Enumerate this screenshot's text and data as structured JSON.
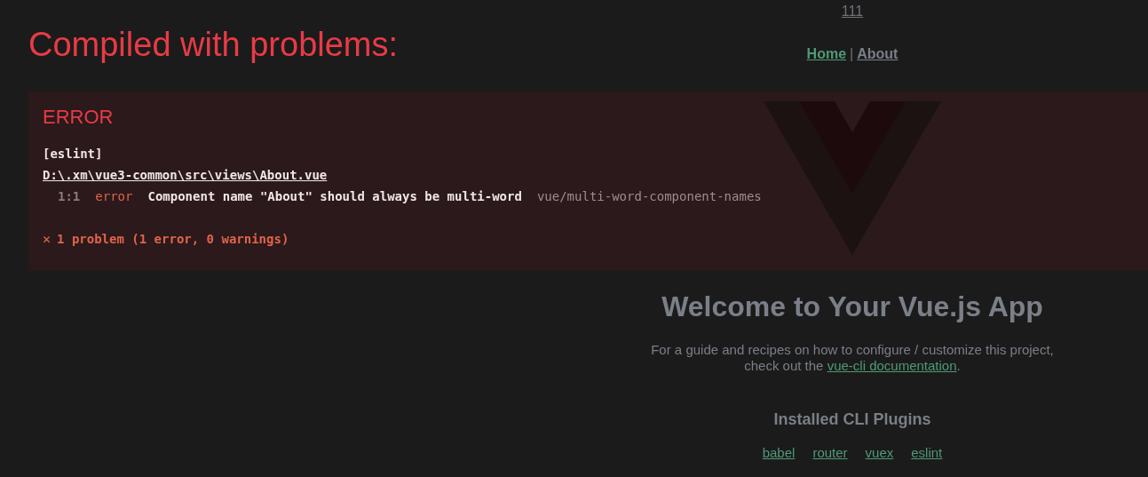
{
  "app": {
    "top_link": "111",
    "nav": [
      {
        "label": "Home",
        "selected": true
      },
      {
        "label": "About",
        "selected": false
      }
    ],
    "nav_separator": "|",
    "heading": "Welcome to Your Vue.js App",
    "intro": "For a guide and recipes on how to configure / customize this project,",
    "intro_line2": "check out the",
    "intro_link": "vue-cli documentation",
    "intro_end": ".",
    "plugins_heading": "Installed CLI Plugins",
    "plugins": [
      "babel",
      "router",
      "vuex",
      "eslint"
    ]
  },
  "overlay": {
    "title": "Compiled with problems:",
    "errors": [
      {
        "label": "ERROR",
        "source": "[eslint]",
        "file": "D:\\.xm\\vue3-common\\src\\views\\About.vue",
        "problems": [
          {
            "position": "1:1",
            "severity": "error",
            "message": "Component name \"About\" should always be multi-word",
            "rule": "vue/multi-word-component-names"
          }
        ],
        "summary_icon": "✕",
        "summary": "1 problem (1 error, 0 warnings)"
      }
    ]
  }
}
